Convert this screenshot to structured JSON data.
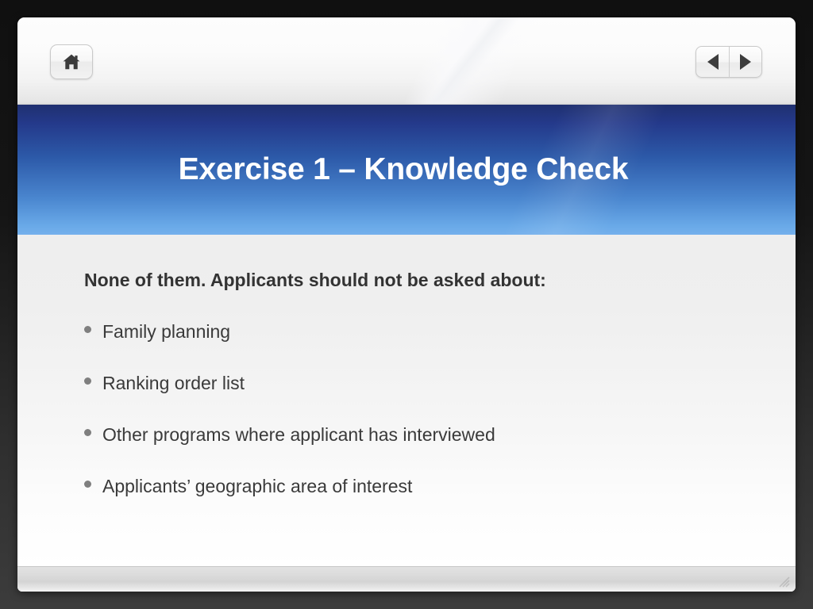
{
  "window": {
    "toolbar": {
      "home_button_label": "Home",
      "home_icon": "home-icon",
      "previous_button_label": "Previous",
      "previous_icon": "triangle-left-icon",
      "next_button_label": "Next",
      "next_icon": "triangle-right-icon"
    },
    "status_bar": {
      "resize_grip_icon": "resize-grip-icon"
    }
  },
  "slide": {
    "title": "Exercise 1 – Knowledge Check",
    "heading": "None of them. Applicants should not be asked about:",
    "bullets": [
      {
        "text": "Family planning"
      },
      {
        "text": "Ranking order list"
      },
      {
        "text": "Other programs where applicant has interviewed"
      },
      {
        "text": "Applicants’ geographic area of interest"
      }
    ]
  },
  "colors": {
    "banner_top": "#1f3070",
    "banner_bottom": "#74b0ec",
    "title_text": "#ffffff",
    "heading_text": "#333333",
    "body_text": "#3a3a3a",
    "bullet_marker": "#7f7f7f",
    "frame_background": "#151515"
  }
}
